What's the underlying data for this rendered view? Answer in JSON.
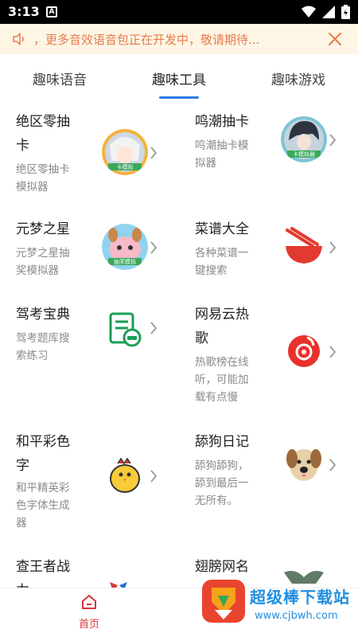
{
  "status_bar": {
    "time": "3:13",
    "notification_letter": "A"
  },
  "notice": {
    "message": "，更多音效语音包正在开发中，敬请期待..."
  },
  "tabs": [
    {
      "label": "趣味语音",
      "active": false
    },
    {
      "label": "趣味工具",
      "active": true
    },
    {
      "label": "趣味游戏",
      "active": false
    }
  ],
  "tools": [
    {
      "title": "绝区零抽卡",
      "desc": "绝区零抽卡模拟器",
      "icon": "anime-girl-avatar",
      "badge": "卡模拟"
    },
    {
      "title": "鸣潮抽卡",
      "desc": "鸣潮抽卡模拟器",
      "icon": "anime-boy-avatar",
      "badge": "卡模拟器"
    },
    {
      "title": "元梦之星",
      "desc": "元梦之星抽奖模拟器",
      "icon": "cute-animal-avatar",
      "badge": "抽奖模拟"
    },
    {
      "title": "菜谱大全",
      "desc": "各种菜谱一键搜索",
      "icon": "noodle-bowl-icon"
    },
    {
      "title": "驾考宝典",
      "desc": "驾考题库搜索练习",
      "icon": "driving-exam-icon"
    },
    {
      "title": "网易云热歌",
      "desc": "热歌榜在线听，可能加载有点慢",
      "icon": "netease-music-icon"
    },
    {
      "title": "和平彩色字",
      "desc": "和平精英彩色字体生成器",
      "icon": "chicken-icon"
    },
    {
      "title": "舔狗日记",
      "desc": "舔狗舔狗，舔到最后一无所有。",
      "icon": "dog-face-icon"
    },
    {
      "title": "查王者战力",
      "desc": "",
      "icon": "honor-of-kings-icon"
    },
    {
      "title": "翅膀网名",
      "desc": "",
      "icon": "wings-icon"
    }
  ],
  "bottom_nav": {
    "home_label": "首页"
  },
  "watermark": {
    "name": "超级棒下载站",
    "url": "www.cjbwh.com"
  },
  "colors": {
    "accent": "#2d7be5",
    "notice_text": "#e9794f",
    "notice_bg": "#fdf6e4",
    "nav_active": "#d7353b"
  }
}
